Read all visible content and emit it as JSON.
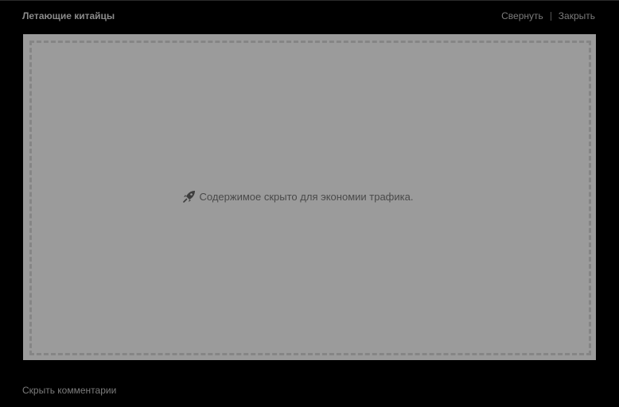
{
  "header": {
    "title": "Летающие китайцы",
    "collapse_label": "Свернуть",
    "close_label": "Закрыть"
  },
  "content": {
    "hidden_notice": "Содержимое скрыто для экономии трафика.",
    "notice_icon": "rocket-icon"
  },
  "footer": {
    "hide_comments_label": "Скрыть комментарии"
  },
  "colors": {
    "background": "#000000",
    "panel": "#9b9b9b",
    "dashed_border": "#858585",
    "link_text": "#7c7c7c",
    "notice_text": "#4a4a4a"
  }
}
